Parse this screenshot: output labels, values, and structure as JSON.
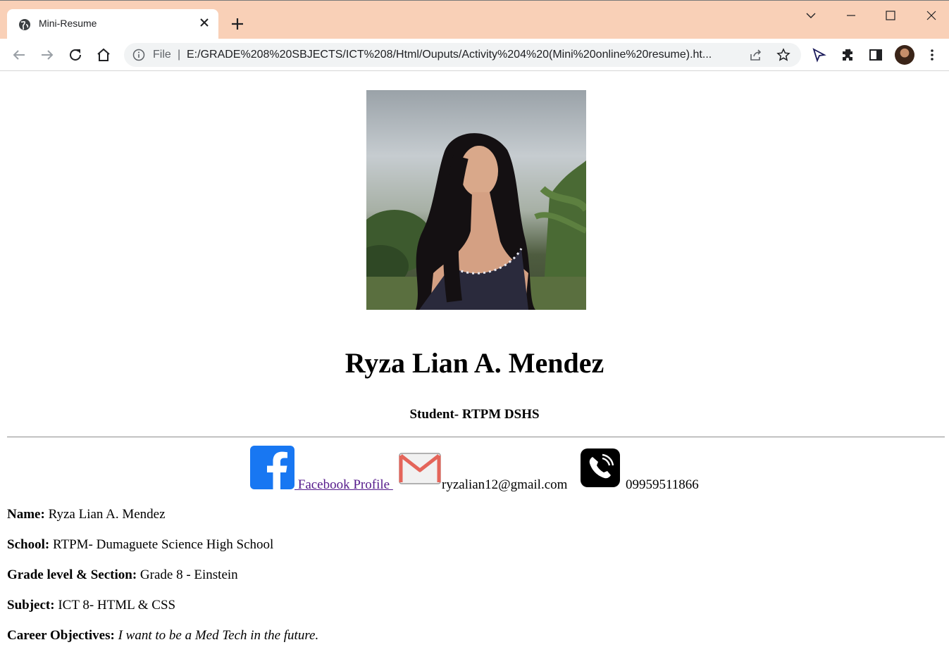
{
  "browser": {
    "tab_title": "Mini-Resume",
    "url_scheme_label": "File",
    "url_separator": "|",
    "url": "E:/GRADE%208%20SBJECTS/ICT%208/Html/Ouputs/Activity%204%20(Mini%20online%20resume).ht...",
    "icons": [
      "globe-icon",
      "close-icon",
      "new-tab-icon",
      "chevron-down-icon",
      "minimize-icon",
      "maximize-icon",
      "window-close-icon",
      "back-icon",
      "forward-icon",
      "reload-icon",
      "home-icon",
      "info-icon",
      "share-icon",
      "star-icon",
      "send-icon",
      "extensions-icon",
      "side-panel-icon",
      "profile-avatar",
      "more-menu-icon"
    ]
  },
  "resume": {
    "name_heading": "Ryza Lian A. Mendez",
    "subtitle": "Student- RTPM DSHS",
    "contacts": {
      "facebook_label": " Facebook Profile ",
      "email": "ryzalian12@gmail.com",
      "phone": "09959511866"
    },
    "details": [
      {
        "label": "Name:",
        "value": " Ryza Lian A. Mendez"
      },
      {
        "label": "School:",
        "value": " RTPM- Dumaguete Science High School"
      },
      {
        "label": "Grade level & Section:",
        "value": " Grade 8 - Einstein"
      },
      {
        "label": "Subject:",
        "value": " ICT 8- HTML & CSS"
      },
      {
        "label": "Career Objectives:",
        "value": " I want to be a Med Tech in the future."
      }
    ]
  },
  "colors": {
    "tabbar_bg": "#f9d0b7",
    "link_visited": "#551a8b",
    "facebook_blue": "#1877f2"
  }
}
